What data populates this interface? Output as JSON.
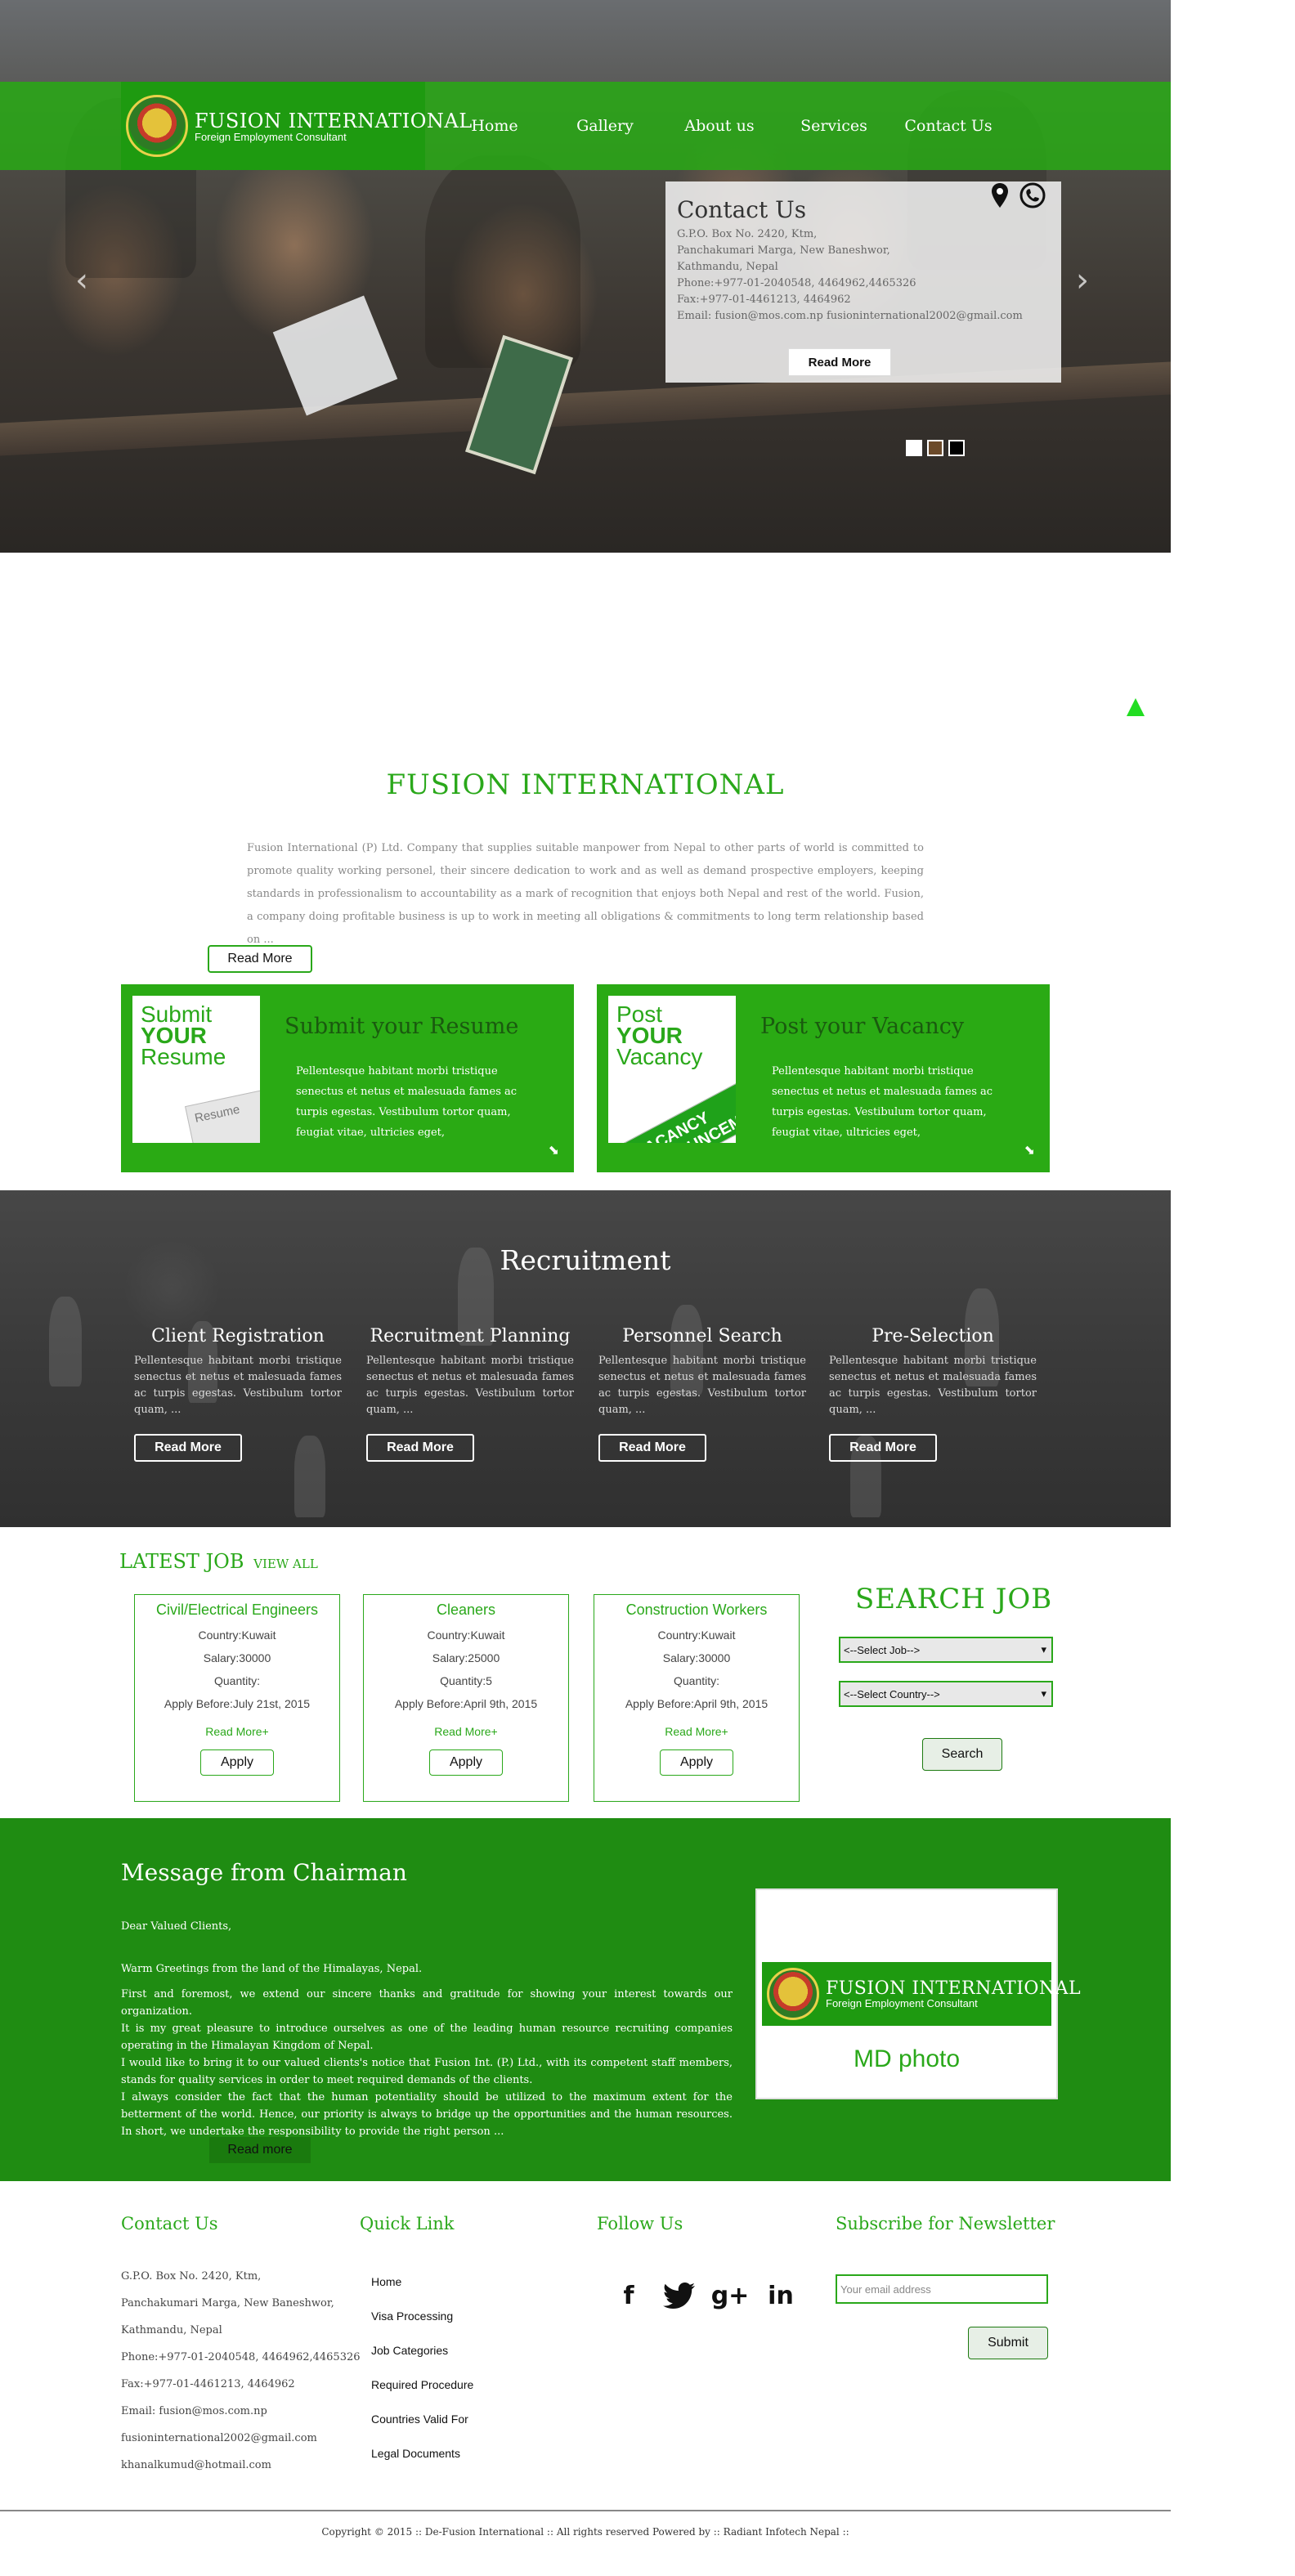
{
  "header": {
    "brand": "FUSION INTERNATIONAL",
    "tagline": "Foreign Employment Consultant",
    "nav": [
      "Home",
      "Gallery",
      "About us",
      "Services",
      "Contact Us"
    ]
  },
  "hero": {
    "contact_title": "Contact Us",
    "contact_lines": [
      "G.P.O. Box No. 2420, Ktm,",
      "Panchakumari Marga, New Baneshwor,",
      "Kathmandu, Nepal",
      "Phone:+977-01-2040548, 4464962,4465326",
      "Fax:+977-01-4461213, 4464962",
      "Email: fusion@mos.com.np fusioninternational2002@gmail.com"
    ],
    "read_more": "Read More",
    "prev": "‹",
    "next": "›",
    "slides": 3,
    "active_slide": 1
  },
  "about": {
    "title": "FUSION INTERNATIONAL",
    "text": "Fusion International (P) Ltd. Company that supplies suitable manpower from Nepal to other parts of world is committed to promote quality working personel, their sincere dedication to work and as well as demand prospective employers, keeping standards in professionalism to accountability as a mark of recognition that enjoys both Nepal and rest of the world. Fusion, a company doing profitable business is up to work in meeting all obligations & commitments to long term relationship based on ...",
    "read_more": "Read More"
  },
  "cards": [
    {
      "img_l1": "Submit",
      "img_l2": "YOUR",
      "img_l3": "Resume",
      "img_deco": "Resume",
      "title": "Submit your Resume",
      "text": "Pellentesque habitant morbi tristique senectus et netus et malesuada fames ac turpis egestas. Vestibulum tortor quam, feugiat vitae, ultricies eget,",
      "icon": "⬊"
    },
    {
      "img_l1": "Post",
      "img_l2": "YOUR",
      "img_l3": "Vacancy",
      "img_deco": "VACANCY ANNOUNCEMENT",
      "title": "Post your Vacancy",
      "text": "Pellentesque habitant morbi tristique senectus et netus et malesuada fames ac turpis egestas. Vestibulum tortor quam, feugiat vitae, ultricies eget,",
      "icon": "⬊"
    }
  ],
  "recruitment": {
    "title": "Recruitment",
    "items": [
      {
        "title": "Client Registration",
        "text": "Pellentesque habitant morbi tristique senectus et netus et malesuada fames ac turpis egestas. Vestibulum tortor quam, ...",
        "button": "Read More"
      },
      {
        "title": "Recruitment Planning",
        "text": "Pellentesque habitant morbi tristique senectus et netus et malesuada fames ac turpis egestas. Vestibulum tortor quam, ...",
        "button": "Read More"
      },
      {
        "title": "Personnel Search",
        "text": "Pellentesque habitant morbi tristique senectus et netus et malesuada fames ac turpis egestas. Vestibulum tortor quam, ...",
        "button": "Read More"
      },
      {
        "title": "Pre-Selection",
        "text": "Pellentesque habitant morbi tristique senectus et netus et malesuada fames ac turpis egestas. Vestibulum tortor quam, ...",
        "button": "Read More"
      }
    ]
  },
  "latest_job": {
    "title": "LATEST JOB",
    "view_all": "VIEW ALL",
    "jobs": [
      {
        "title": "Civil/Electrical Engineers",
        "country": "Country:Kuwait",
        "salary": "Salary:30000",
        "quantity": "Quantity:",
        "apply_before": "Apply Before:July 21st, 2015",
        "more": "Read More+",
        "apply": "Apply"
      },
      {
        "title": "Cleaners",
        "country": "Country:Kuwait",
        "salary": "Salary:25000",
        "quantity": "Quantity:5",
        "apply_before": "Apply Before:April 9th, 2015",
        "more": "Read More+",
        "apply": "Apply"
      },
      {
        "title": "Construction Workers",
        "country": "Country:Kuwait",
        "salary": "Salary:30000",
        "quantity": "Quantity:",
        "apply_before": "Apply Before:April 9th, 2015",
        "more": "Read More+",
        "apply": "Apply"
      }
    ]
  },
  "search_job": {
    "title": "SEARCH JOB",
    "job_select": "<--Select Job-->",
    "country_select": "<--Select Country-->",
    "button": "Search"
  },
  "chairman": {
    "title": "Message from Chairman",
    "greeting": "Dear Valued Clients,",
    "para1": "Warm Greetings from the land of the Himalayas, Nepal.",
    "para2": "First and foremost, we extend our sincere thanks and gratitude for showing your interest towards our organization.",
    "para3": "It is my great pleasure to introduce ourselves as one of the leading human resource recruiting companies operating in the Himalayan Kingdom of Nepal.",
    "para4": "I would like to bring it to our valued clients's notice that Fusion Int. (P.) Ltd., with its competent staff members, stands for quality services in order to meet required demands of the clients.",
    "para5": "I always consider the fact that the human potentiality should be utilized to the maximum extent for the betterment of the world. Hence, our priority is always to bridge up the opportunities and the human resources. In short, we undertake the responsibility to provide the right person ...",
    "read_more": "Read more",
    "photo_caption": "MD photo"
  },
  "footer": {
    "contact_title": "Contact Us",
    "contact_lines": [
      "G.P.O. Box No. 2420, Ktm,",
      "Panchakumari Marga, New Baneshwor,",
      "Kathmandu, Nepal",
      "Phone:+977-01-2040548, 4464962,4465326",
      "Fax:+977-01-4461213, 4464962",
      "Email: fusion@mos.com.np",
      "fusioninternational2002@gmail.com",
      "khanalkumud@hotmail.com"
    ],
    "quick_title": "Quick Link",
    "quick_links": [
      "Home",
      "Visa Processing",
      "Job Categories",
      "Required Procedure",
      "Countries Valid For",
      "Legal Documents"
    ],
    "follow_title": "Follow Us",
    "social": [
      "f",
      "🐦",
      "g+",
      "in"
    ],
    "newsletter_title": "Subscribe for Newsletter",
    "email_placeholder": "Your email address",
    "submit": "Submit",
    "copyright": "Copyright © 2015 :: De-Fusion International :: All rights reserved Powered by :: Radiant Infotech Nepal ::"
  },
  "colors": {
    "brand_green": "#2aa81a",
    "dark_green": "#1f8c12"
  }
}
